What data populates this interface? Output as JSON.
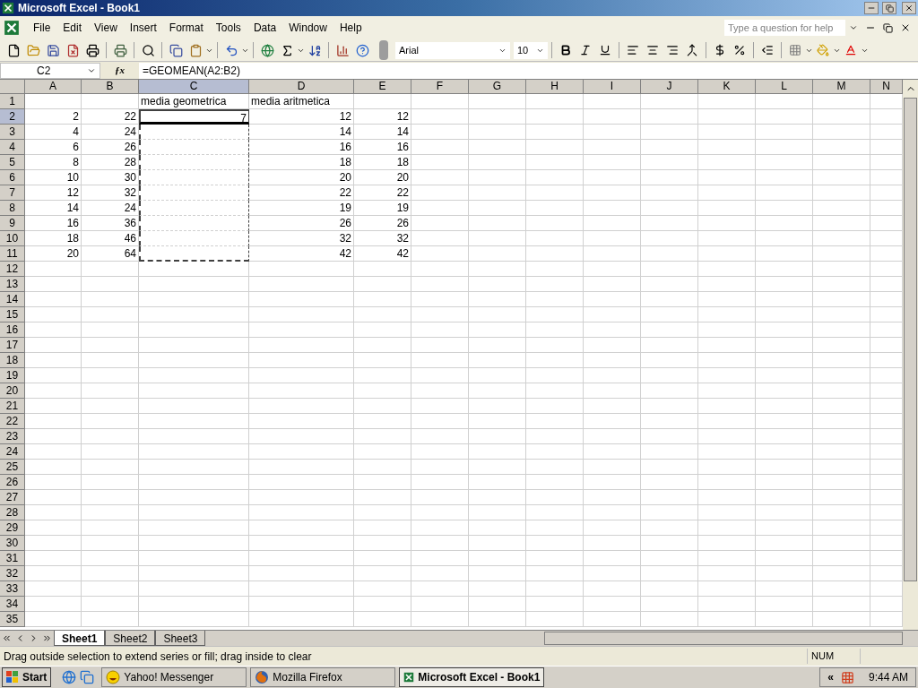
{
  "window": {
    "title": "Microsoft Excel - Book1"
  },
  "menu": [
    "File",
    "Edit",
    "View",
    "Insert",
    "Format",
    "Tools",
    "Data",
    "Window",
    "Help"
  ],
  "help_box": {
    "placeholder": "Type a question for help"
  },
  "format_toolbar": {
    "font": "Arial",
    "size": "10"
  },
  "formula_bar": {
    "name_box": "C2",
    "fx": "ƒx",
    "formula": "=GEOMEAN(A2:B2)"
  },
  "columns": [
    {
      "label": "A",
      "selected": false
    },
    {
      "label": "B",
      "selected": false
    },
    {
      "label": "C",
      "selected": true
    },
    {
      "label": "D",
      "selected": false
    },
    {
      "label": "E",
      "selected": false
    },
    {
      "label": "F",
      "selected": false
    },
    {
      "label": "G",
      "selected": false
    },
    {
      "label": "H",
      "selected": false
    },
    {
      "label": "I",
      "selected": false
    },
    {
      "label": "J",
      "selected": false
    },
    {
      "label": "K",
      "selected": false
    },
    {
      "label": "L",
      "selected": false
    },
    {
      "label": "M",
      "selected": false
    },
    {
      "label": "N",
      "selected": false
    }
  ],
  "rows": [
    {
      "label": "1",
      "selected": false,
      "cells": [
        null,
        null,
        {
          "text": "media geometrica",
          "kind": "text"
        },
        {
          "text": "media aritmetica",
          "kind": "text"
        }
      ]
    },
    {
      "label": "2",
      "selected": true,
      "cells": [
        {
          "text": "2",
          "kind": "number"
        },
        {
          "text": "22",
          "kind": "number"
        },
        {
          "text": "7",
          "kind": "number",
          "active": true,
          "marquee": true
        },
        {
          "text": "12",
          "kind": "number"
        },
        {
          "text": "12",
          "kind": "number"
        }
      ]
    },
    {
      "label": "3",
      "selected": false,
      "cells": [
        {
          "text": "4",
          "kind": "number"
        },
        {
          "text": "24",
          "kind": "number"
        },
        {
          "marquee": true
        },
        {
          "text": "14",
          "kind": "number"
        },
        {
          "text": "14",
          "kind": "number"
        }
      ]
    },
    {
      "label": "4",
      "selected": false,
      "cells": [
        {
          "text": "6",
          "kind": "number"
        },
        {
          "text": "26",
          "kind": "number"
        },
        {
          "marquee": true
        },
        {
          "text": "16",
          "kind": "number"
        },
        {
          "text": "16",
          "kind": "number"
        }
      ]
    },
    {
      "label": "5",
      "selected": false,
      "cells": [
        {
          "text": "8",
          "kind": "number"
        },
        {
          "text": "28",
          "kind": "number"
        },
        {
          "marquee": true
        },
        {
          "text": "18",
          "kind": "number"
        },
        {
          "text": "18",
          "kind": "number"
        }
      ]
    },
    {
      "label": "6",
      "selected": false,
      "cells": [
        {
          "text": "10",
          "kind": "number"
        },
        {
          "text": "30",
          "kind": "number"
        },
        {
          "marquee": true
        },
        {
          "text": "20",
          "kind": "number"
        },
        {
          "text": "20",
          "kind": "number"
        }
      ]
    },
    {
      "label": "7",
      "selected": false,
      "cells": [
        {
          "text": "12",
          "kind": "number"
        },
        {
          "text": "32",
          "kind": "number"
        },
        {
          "marquee": true
        },
        {
          "text": "22",
          "kind": "number"
        },
        {
          "text": "22",
          "kind": "number"
        }
      ]
    },
    {
      "label": "8",
      "selected": false,
      "cells": [
        {
          "text": "14",
          "kind": "number"
        },
        {
          "text": "24",
          "kind": "number"
        },
        {
          "marquee": true
        },
        {
          "text": "19",
          "kind": "number"
        },
        {
          "text": "19",
          "kind": "number"
        }
      ]
    },
    {
      "label": "9",
      "selected": false,
      "cells": [
        {
          "text": "16",
          "kind": "number"
        },
        {
          "text": "36",
          "kind": "number"
        },
        {
          "marquee": true
        },
        {
          "text": "26",
          "kind": "number"
        },
        {
          "text": "26",
          "kind": "number"
        }
      ]
    },
    {
      "label": "10",
      "selected": false,
      "cells": [
        {
          "text": "18",
          "kind": "number"
        },
        {
          "text": "46",
          "kind": "number"
        },
        {
          "marquee": true
        },
        {
          "text": "32",
          "kind": "number"
        },
        {
          "text": "32",
          "kind": "number"
        }
      ]
    },
    {
      "label": "11",
      "selected": false,
      "cells": [
        {
          "text": "20",
          "kind": "number"
        },
        {
          "text": "64",
          "kind": "number"
        },
        {
          "marquee": true
        },
        {
          "text": "42",
          "kind": "number"
        },
        {
          "text": "42",
          "kind": "number"
        }
      ]
    },
    {
      "label": "12",
      "selected": false
    },
    {
      "label": "13",
      "selected": false
    },
    {
      "label": "14",
      "selected": false
    },
    {
      "label": "15",
      "selected": false
    },
    {
      "label": "16",
      "selected": false
    },
    {
      "label": "17",
      "selected": false
    },
    {
      "label": "18",
      "selected": false
    },
    {
      "label": "19",
      "selected": false
    },
    {
      "label": "20",
      "selected": false
    },
    {
      "label": "21",
      "selected": false
    },
    {
      "label": "22",
      "selected": false
    },
    {
      "label": "23",
      "selected": false
    },
    {
      "label": "24",
      "selected": false
    },
    {
      "label": "25",
      "selected": false
    },
    {
      "label": "26",
      "selected": false
    },
    {
      "label": "27",
      "selected": false
    },
    {
      "label": "28",
      "selected": false
    },
    {
      "label": "29",
      "selected": false
    },
    {
      "label": "30",
      "selected": false
    },
    {
      "label": "31",
      "selected": false
    },
    {
      "label": "32",
      "selected": false
    },
    {
      "label": "33",
      "selected": false
    },
    {
      "label": "34",
      "selected": false
    },
    {
      "label": "35",
      "selected": false
    }
  ],
  "sheet_tabs": [
    {
      "label": "Sheet1",
      "selected": true
    },
    {
      "label": "Sheet2",
      "selected": false
    },
    {
      "label": "Sheet3",
      "selected": false
    }
  ],
  "status_bar": {
    "message": "Drag outside selection to extend series or fill; drag inside to clear",
    "num": "NUM"
  },
  "taskbar": {
    "start": "Start",
    "tasks": [
      {
        "label": "Yahoo! Messenger",
        "kind": "yahoo",
        "selected": false
      },
      {
        "label": "Mozilla Firefox",
        "kind": "firefox",
        "selected": false
      },
      {
        "label": "Microsoft Excel - Book1",
        "kind": "excel",
        "selected": true
      }
    ],
    "chevron": "«",
    "time": "9:44 AM"
  }
}
